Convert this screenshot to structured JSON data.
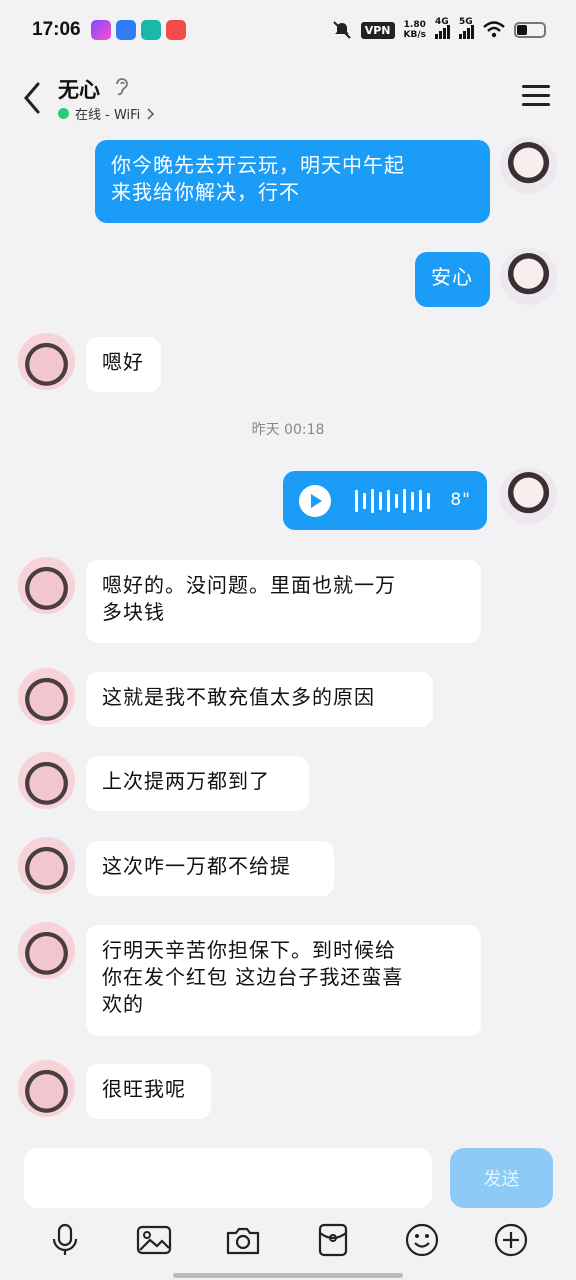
{
  "status_bar": {
    "time": "17:06",
    "vpn": "VPN",
    "net_speed_value": "1.80",
    "net_speed_unit": "KB/s",
    "signal1": "4G",
    "signal2": "5G"
  },
  "header": {
    "contact_name": "无心",
    "presence": "在线 - WiFi",
    "presence_color": "#2ecc71"
  },
  "messages": [
    {
      "side": "me",
      "type": "text",
      "text": "你今晚先去开云玩，明天中午起\n来我给你解决，行不"
    },
    {
      "side": "me",
      "type": "text",
      "text": "安心"
    },
    {
      "side": "peer",
      "type": "text",
      "text": "嗯好"
    },
    {
      "type": "timestamp",
      "text": "昨天 00:18"
    },
    {
      "side": "me",
      "type": "voice",
      "duration": "8\""
    },
    {
      "side": "peer",
      "type": "text",
      "text": "嗯好的。没问题。里面也就一万\n多块钱"
    },
    {
      "side": "peer",
      "type": "text",
      "text": "这就是我不敢充值太多的原因"
    },
    {
      "side": "peer",
      "type": "text",
      "text": "上次提两万都到了"
    },
    {
      "side": "peer",
      "type": "text",
      "text": "这次咋一万都不给提"
    },
    {
      "side": "peer",
      "type": "text",
      "text": "行明天辛苦你担保下。到时候给\n你在发个红包 这边台子我还蛮喜\n欢的"
    },
    {
      "side": "peer",
      "type": "text",
      "text": "很旺我呢"
    }
  ],
  "input_bar": {
    "input_value": "",
    "send_label": "发送"
  },
  "toolbar": {
    "icons": [
      "microphone-icon",
      "image-icon",
      "camera-icon",
      "red-packet-icon",
      "emoji-icon",
      "plus-icon"
    ]
  },
  "colors": {
    "my_bubble": "#1b9df7",
    "peer_bubble": "#ffffff",
    "background": "#f2f2f4",
    "send_button": "#8dcbf6"
  }
}
